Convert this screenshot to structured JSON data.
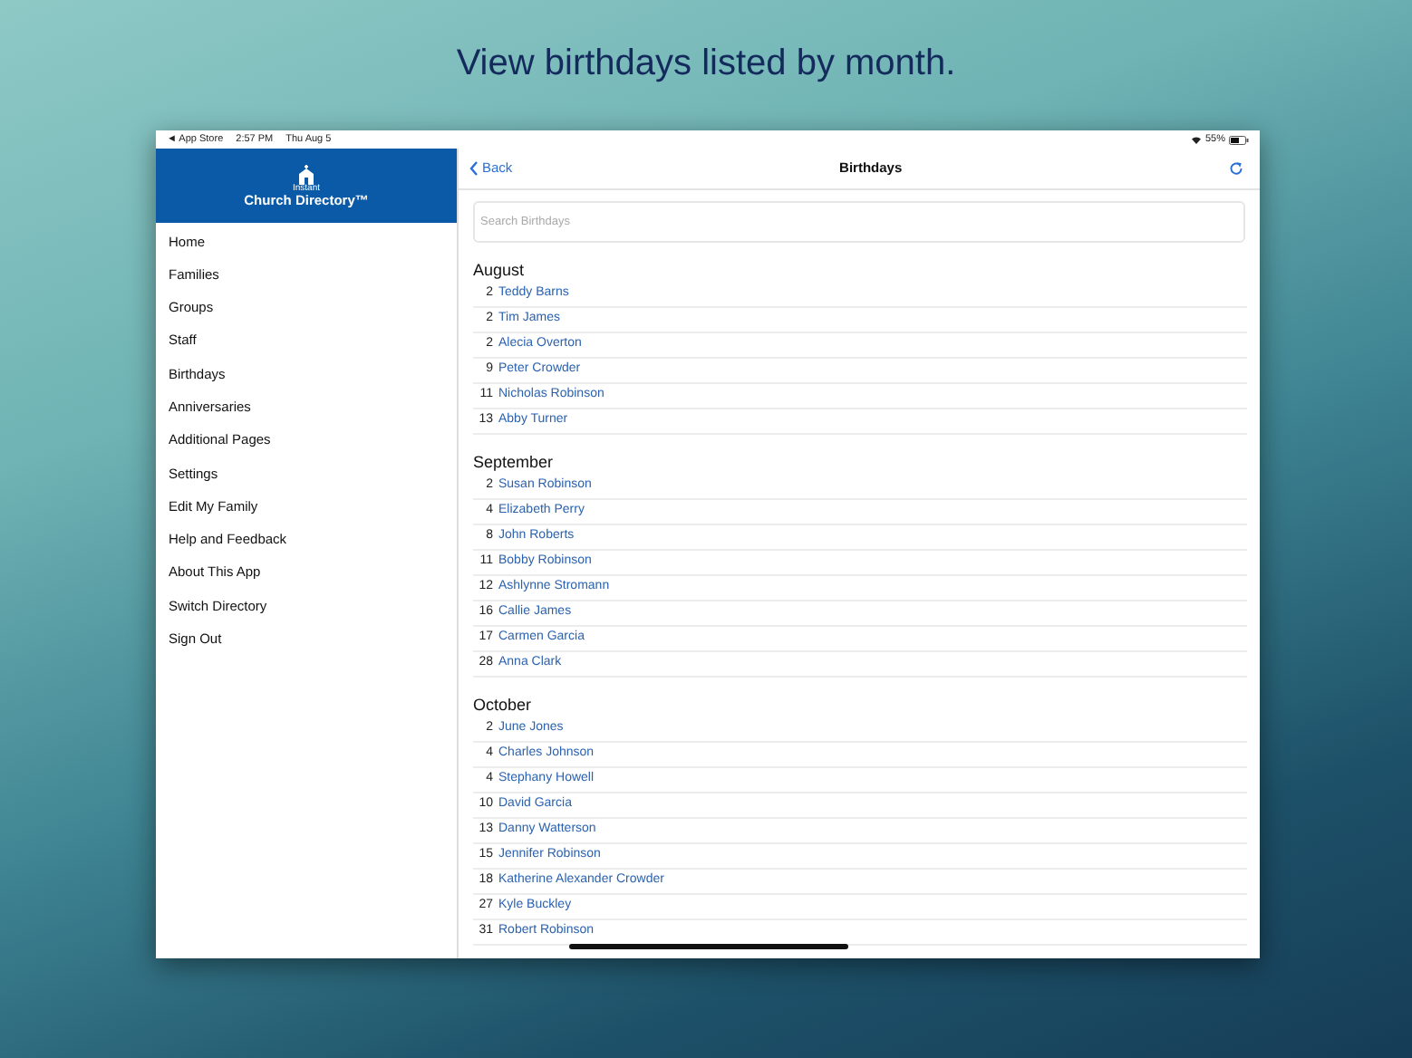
{
  "headline": "View birthdays listed by month.",
  "status_bar": {
    "back_app": "◄ App Store",
    "time": "2:57 PM",
    "date": "Thu Aug 5",
    "battery": "55%"
  },
  "sidebar": {
    "logo_small": "Instant",
    "logo_main": "Church Directory™",
    "items": [
      "Home",
      "Families",
      "Groups",
      "Staff",
      "Birthdays",
      "Anniversaries",
      "Additional Pages",
      "Settings",
      "Edit My Family",
      "Help and Feedback",
      "About This App",
      "Switch Directory",
      "Sign Out"
    ]
  },
  "nav": {
    "back": "Back",
    "title": "Birthdays"
  },
  "search": {
    "placeholder": "Search Birthdays"
  },
  "months": [
    {
      "name": "August",
      "birthdays": [
        {
          "day": "2",
          "name": "Teddy Barns"
        },
        {
          "day": "2",
          "name": "Tim James"
        },
        {
          "day": "2",
          "name": "Alecia Overton"
        },
        {
          "day": "9",
          "name": "Peter Crowder"
        },
        {
          "day": "11",
          "name": "Nicholas Robinson"
        },
        {
          "day": "13",
          "name": "Abby Turner"
        }
      ]
    },
    {
      "name": "September",
      "birthdays": [
        {
          "day": "2",
          "name": "Susan Robinson"
        },
        {
          "day": "4",
          "name": "Elizabeth Perry"
        },
        {
          "day": "8",
          "name": "John Roberts"
        },
        {
          "day": "11",
          "name": "Bobby Robinson"
        },
        {
          "day": "12",
          "name": "Ashlynne Stromann"
        },
        {
          "day": "16",
          "name": "Callie James"
        },
        {
          "day": "17",
          "name": "Carmen Garcia"
        },
        {
          "day": "28",
          "name": "Anna Clark"
        }
      ]
    },
    {
      "name": "October",
      "birthdays": [
        {
          "day": "2",
          "name": "June Jones"
        },
        {
          "day": "4",
          "name": "Charles Johnson"
        },
        {
          "day": "4",
          "name": "Stephany Howell"
        },
        {
          "day": "10",
          "name": "David Garcia"
        },
        {
          "day": "13",
          "name": "Danny Watterson"
        },
        {
          "day": "15",
          "name": "Jennifer Robinson"
        },
        {
          "day": "18",
          "name": "Katherine Alexander Crowder"
        },
        {
          "day": "27",
          "name": "Kyle Buckley"
        },
        {
          "day": "31",
          "name": "Robert Robinson"
        }
      ]
    }
  ]
}
